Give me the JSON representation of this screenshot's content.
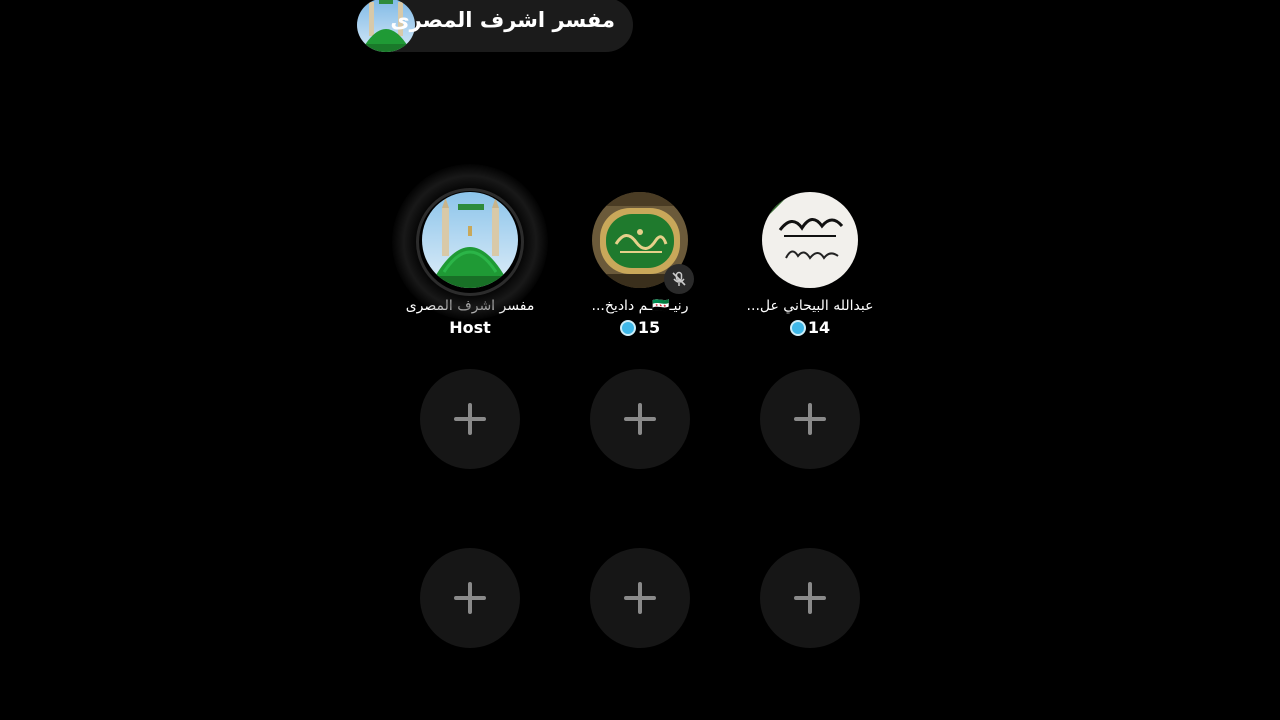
{
  "header": {
    "host_name": "مفسر اشرف المصرى",
    "avatar_icon": "mosque-dome-icon"
  },
  "seats": [
    {
      "name": "مفسر اشرف المصرى",
      "sub": "Host",
      "role": "host",
      "avatar_icon": "mosque-dome-icon",
      "muted": false
    },
    {
      "name": "رنيـ🇸🇾ـم داديخ...",
      "sub": "15",
      "role": "guest",
      "avatar_icon": "calligraphy-plaque-icon",
      "muted": true
    },
    {
      "name": "عبدالله البيحاني عل...",
      "sub": "14",
      "role": "guest",
      "avatar_icon": "abdullah-calligraphy-icon",
      "muted": false
    }
  ],
  "empty_seats": {
    "count": 6,
    "icon": "plus-icon"
  },
  "colors": {
    "background": "#000000",
    "pill": "#1b1b1b",
    "empty_seat": "#161616",
    "coin": "#3fb8e8",
    "dome_green": "#1f8f2f"
  }
}
